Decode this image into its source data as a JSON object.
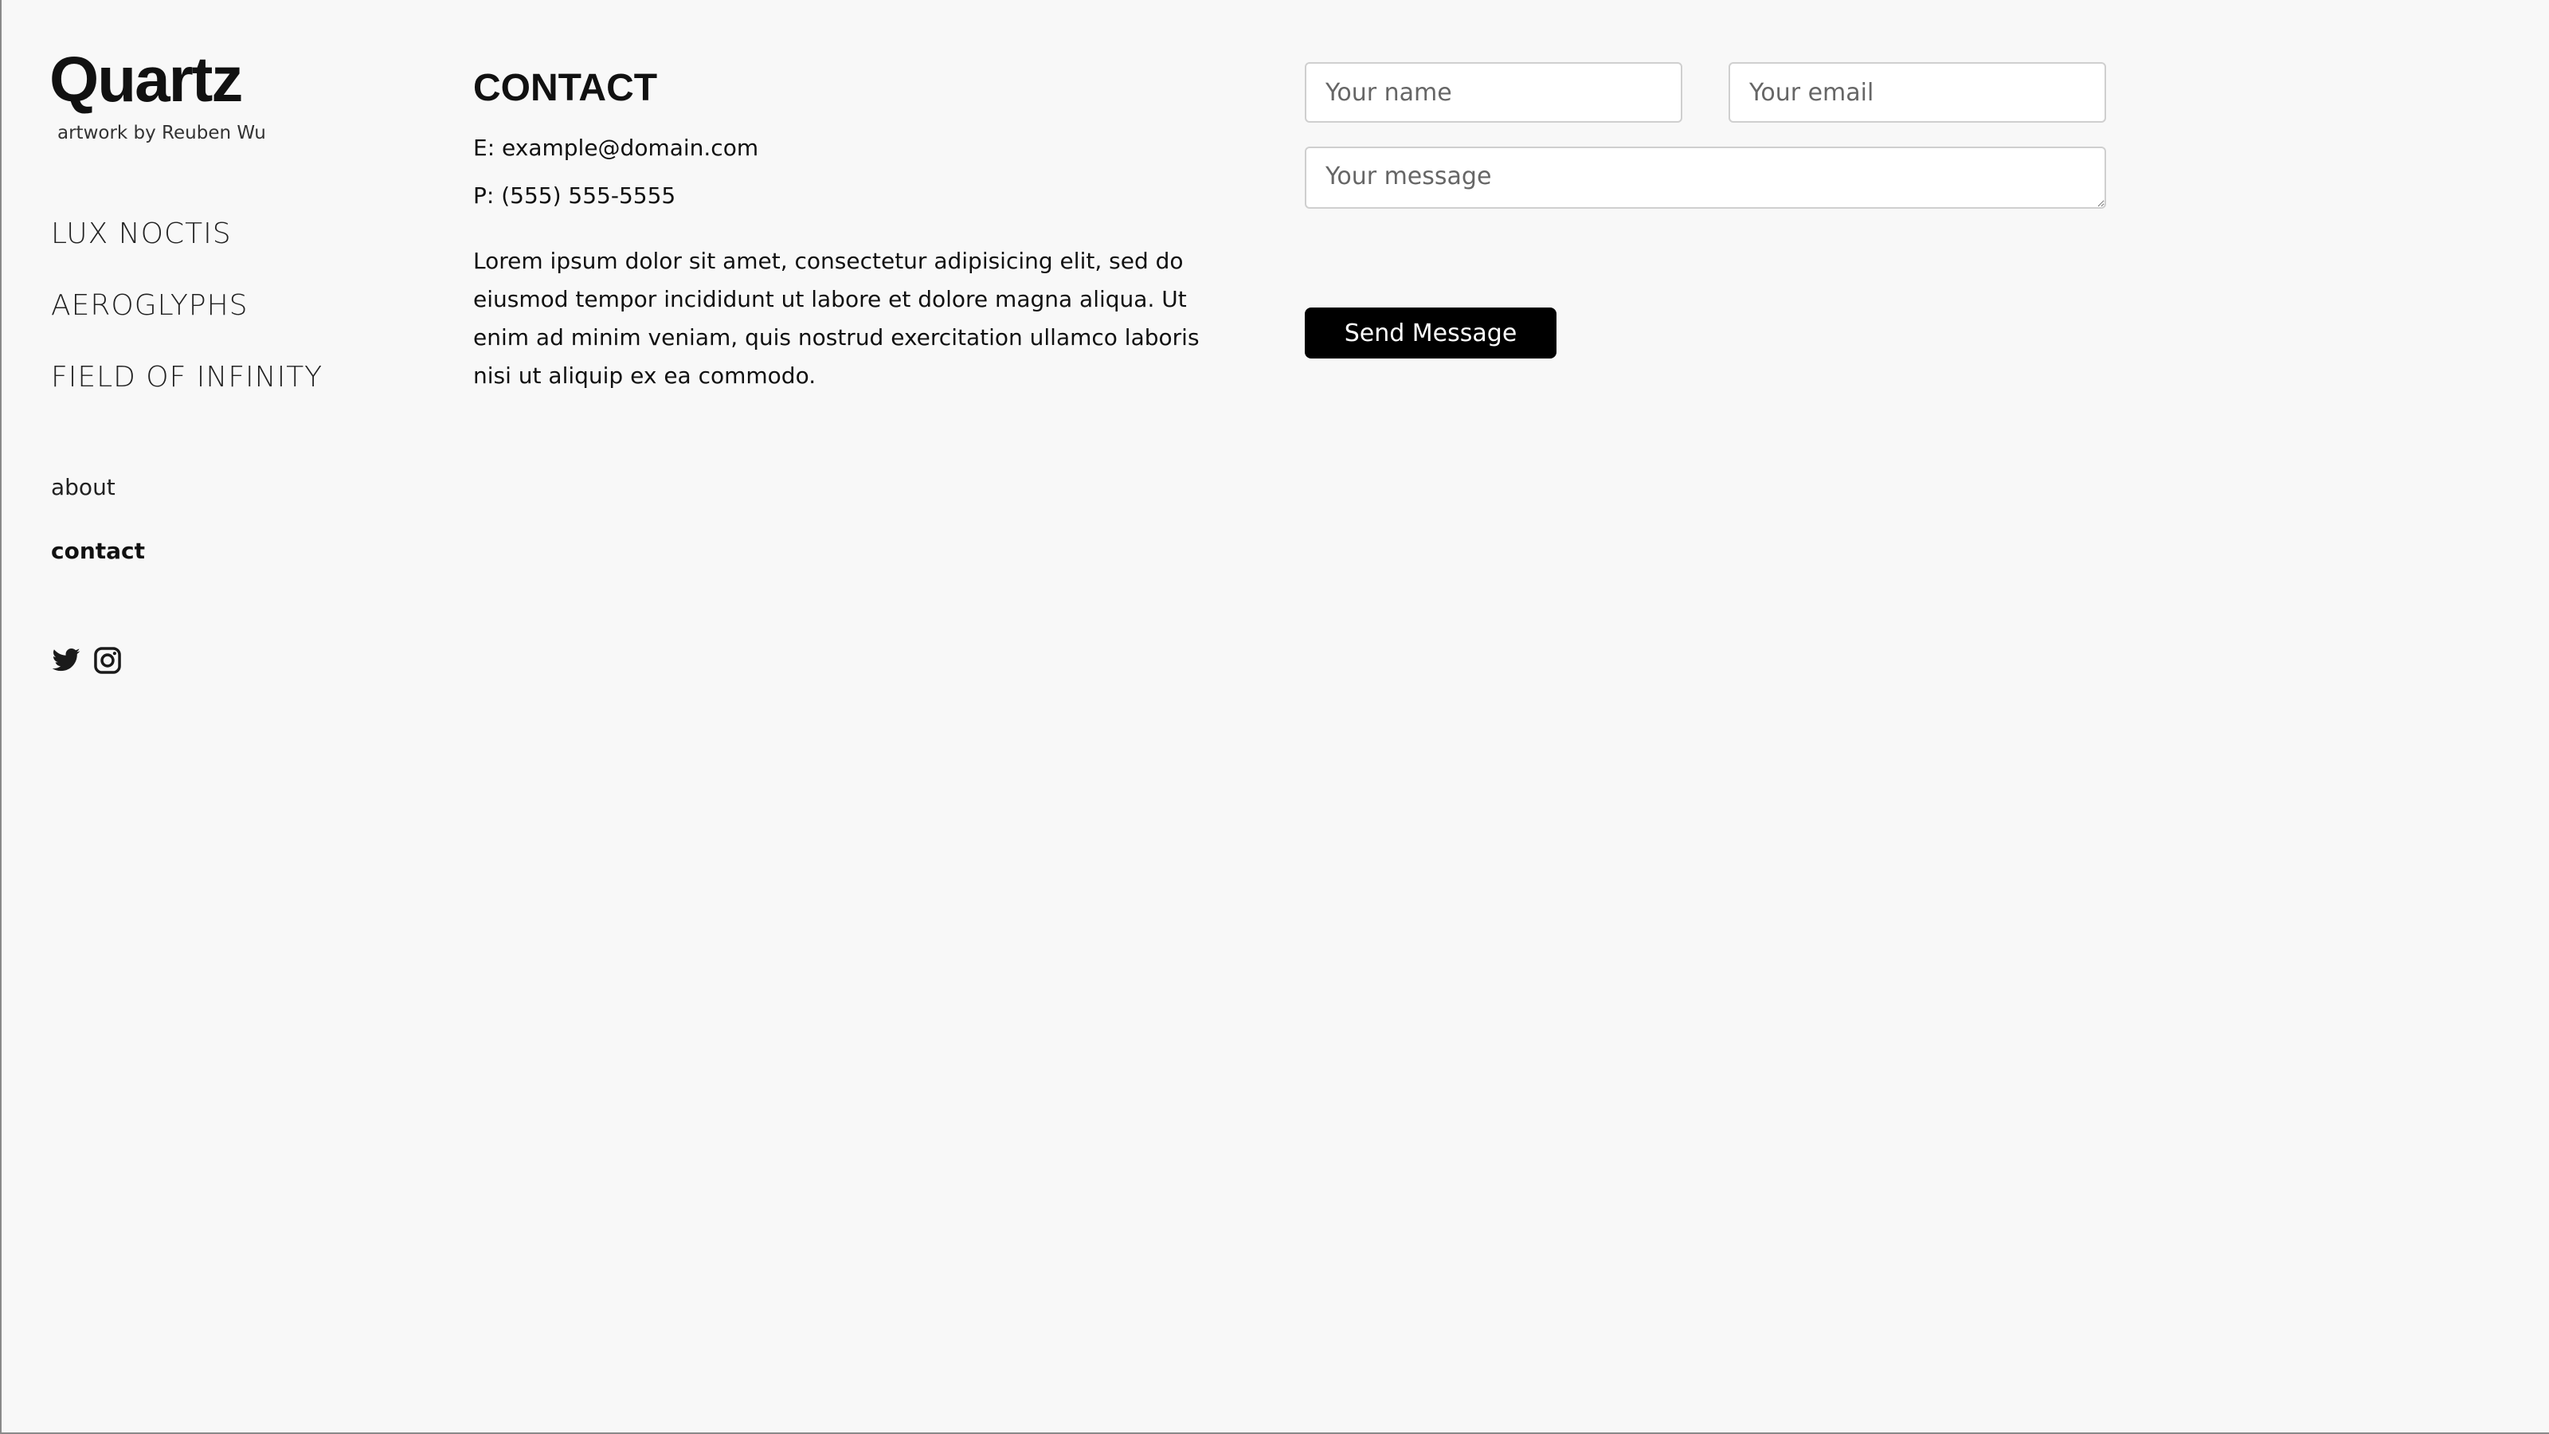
{
  "brand": {
    "title": "Quartz",
    "subtitle": "artwork by Reuben Wu"
  },
  "nav": {
    "main": [
      {
        "label": "LUX NOCTIS"
      },
      {
        "label": "AEROGLYPHS"
      },
      {
        "label": "FIELD OF INFINITY"
      }
    ],
    "secondary": [
      {
        "label": "about",
        "active": false
      },
      {
        "label": "contact",
        "active": true
      }
    ]
  },
  "social": {
    "icons": [
      "twitter-icon",
      "instagram-icon"
    ]
  },
  "contact": {
    "title": "CONTACT",
    "email_line": "E: example@domain.com",
    "phone_line": "P: (555) 555-5555",
    "body": "Lorem ipsum dolor sit amet, consectetur adipisicing elit, sed do eiusmod tempor incididunt ut labore et dolore magna aliqua. Ut enim ad minim veniam, quis nostrud exercitation ullamco laboris nisi ut aliquip ex ea commodo."
  },
  "form": {
    "name_placeholder": "Your name",
    "email_placeholder": "Your email",
    "message_placeholder": "Your message",
    "submit_label": "Send Message"
  },
  "colors": {
    "background": "#f8f8f8",
    "text": "#111111",
    "button": "#000000",
    "button_text": "#ffffff"
  }
}
